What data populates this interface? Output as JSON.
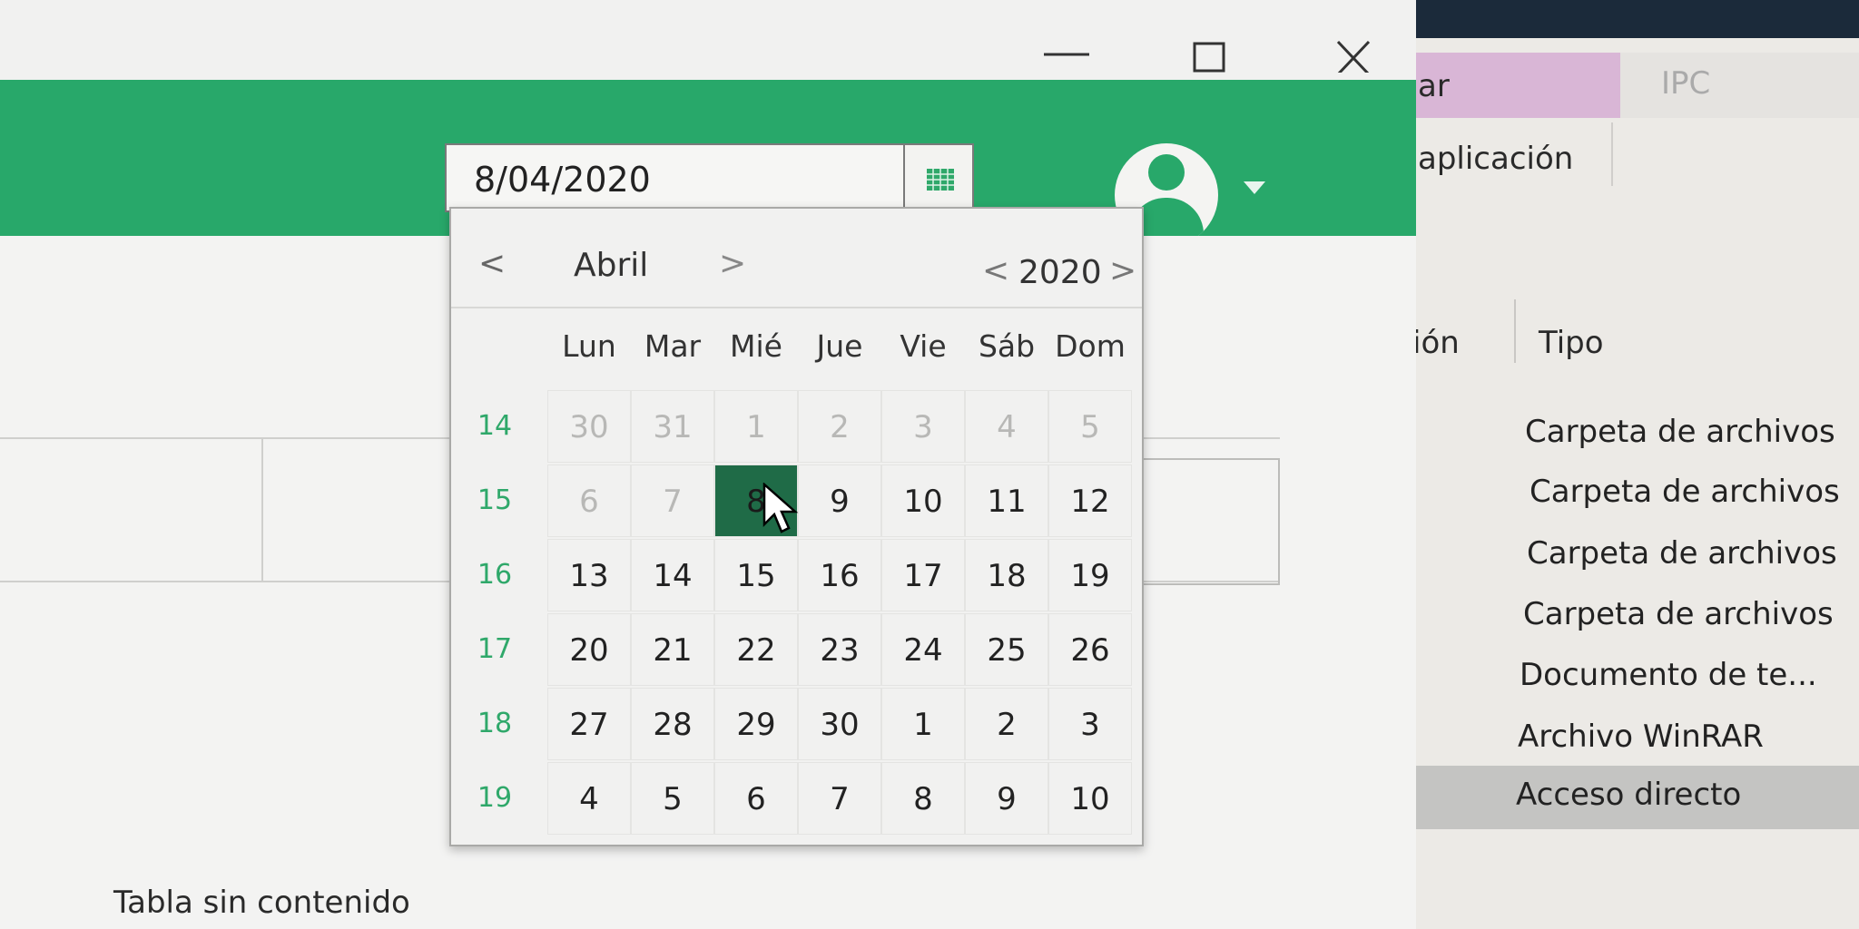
{
  "window": {
    "caption_buttons": [
      "minimize",
      "maximize",
      "close"
    ]
  },
  "header": {
    "date_value": "8/04/2020",
    "colors": {
      "brand": "#28a86a",
      "selected_day": "#1f6b47"
    }
  },
  "calendar": {
    "month": "Abril",
    "year": "2020",
    "prev_symbol": "<",
    "next_symbol": ">",
    "weekdays": [
      "Lun",
      "Mar",
      "Mié",
      "Jue",
      "Vie",
      "Sáb",
      "Dom"
    ],
    "weeks": [
      {
        "num": "14",
        "days": [
          {
            "d": "30",
            "muted": true
          },
          {
            "d": "31",
            "muted": true
          },
          {
            "d": "1",
            "muted": true
          },
          {
            "d": "2",
            "muted": true
          },
          {
            "d": "3",
            "muted": true
          },
          {
            "d": "4",
            "muted": true
          },
          {
            "d": "5",
            "muted": true
          }
        ]
      },
      {
        "num": "15",
        "days": [
          {
            "d": "6",
            "muted": true
          },
          {
            "d": "7",
            "muted": true
          },
          {
            "d": "8",
            "selected": true
          },
          {
            "d": "9"
          },
          {
            "d": "10"
          },
          {
            "d": "11"
          },
          {
            "d": "12"
          }
        ]
      },
      {
        "num": "16",
        "days": [
          {
            "d": "13"
          },
          {
            "d": "14"
          },
          {
            "d": "15"
          },
          {
            "d": "16"
          },
          {
            "d": "17"
          },
          {
            "d": "18"
          },
          {
            "d": "19"
          }
        ]
      },
      {
        "num": "17",
        "days": [
          {
            "d": "20"
          },
          {
            "d": "21"
          },
          {
            "d": "22"
          },
          {
            "d": "23"
          },
          {
            "d": "24"
          },
          {
            "d": "25"
          },
          {
            "d": "26"
          }
        ]
      },
      {
        "num": "18",
        "days": [
          {
            "d": "27"
          },
          {
            "d": "28"
          },
          {
            "d": "29"
          },
          {
            "d": "30"
          },
          {
            "d": "1"
          },
          {
            "d": "2"
          },
          {
            "d": "3"
          }
        ]
      },
      {
        "num": "19",
        "days": [
          {
            "d": "4"
          },
          {
            "d": "5"
          },
          {
            "d": "6"
          },
          {
            "d": "7"
          },
          {
            "d": "8"
          },
          {
            "d": "9"
          },
          {
            "d": "10"
          }
        ]
      }
    ]
  },
  "content": {
    "empty_table_text": "Tabla sin contenido"
  },
  "background_window": {
    "ribbon_tab_a": "ar",
    "ribbon_tab_b": "IPC",
    "ribbon_group": "aplicación",
    "column_left": "ión",
    "column_tipo": "Tipo",
    "file_types": [
      "Carpeta de archivos",
      "Carpeta de archivos",
      "Carpeta de archivos",
      "Carpeta de archivos",
      "Documento de te...",
      "Archivo WinRAR",
      "Acceso directo"
    ]
  }
}
